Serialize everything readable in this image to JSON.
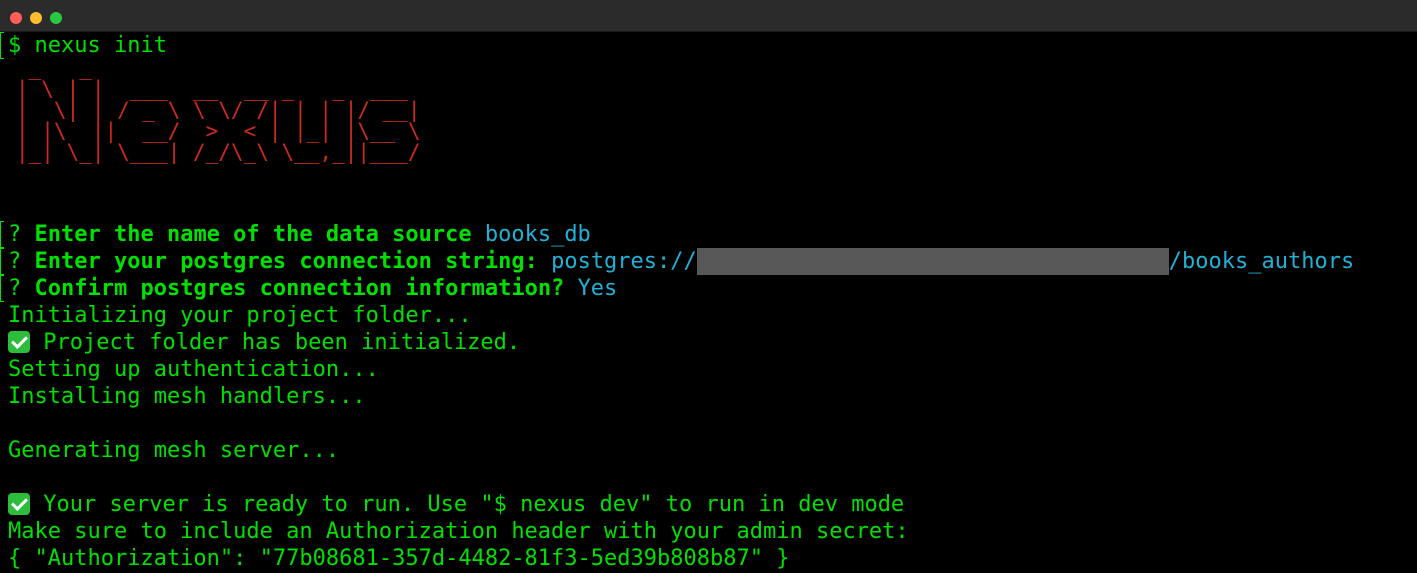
{
  "window": {
    "buttons": [
      "close",
      "minimize",
      "zoom"
    ],
    "colors": {
      "close": "#ff5f57",
      "minimize": "#febc2e",
      "zoom": "#28c840"
    }
  },
  "terminal": {
    "colors": {
      "text": "#00e100",
      "value": "#22b1d6",
      "banner": "#cc2a1d",
      "redaction": "#575757"
    },
    "command": "$ nexus init",
    "banner": " _   _\n| \\ | |  ___  __  __ _   _  ___\n|  \\| | / _ \\ \\ \\/ /| | | |/ __|\n| |\\  ||  __/  >  < | |_| |\\__ \\\n|_| \\_| \\___| /_/\\_\\ \\__,_||___/",
    "prompts": [
      {
        "mark": "?",
        "label": "Enter the name of the data source",
        "answer": "books_db"
      },
      {
        "mark": "?",
        "label": "Enter your postgres connection string:",
        "answer_prefix": "postgres://",
        "answer_suffix": "/books_authors"
      },
      {
        "mark": "?",
        "label": "Confirm postgres connection information?",
        "answer": "Yes"
      }
    ],
    "output": {
      "init": "Initializing your project folder...",
      "init_done": " Project folder has been initialized.",
      "auth": "Setting up authentication...",
      "mesh": "Installing mesh handlers...",
      "server": "Generating mesh server...",
      "ready": " Your server is ready to run. Use \"$ nexus dev\" to run in dev mode",
      "note": "Make sure to include an Authorization header with your admin secret:",
      "secret": "{ \"Authorization\": \"77b08681-357d-4482-81f3-5ed39b808b87\" }"
    },
    "icons": {
      "success": "check-mark-button-icon"
    }
  }
}
